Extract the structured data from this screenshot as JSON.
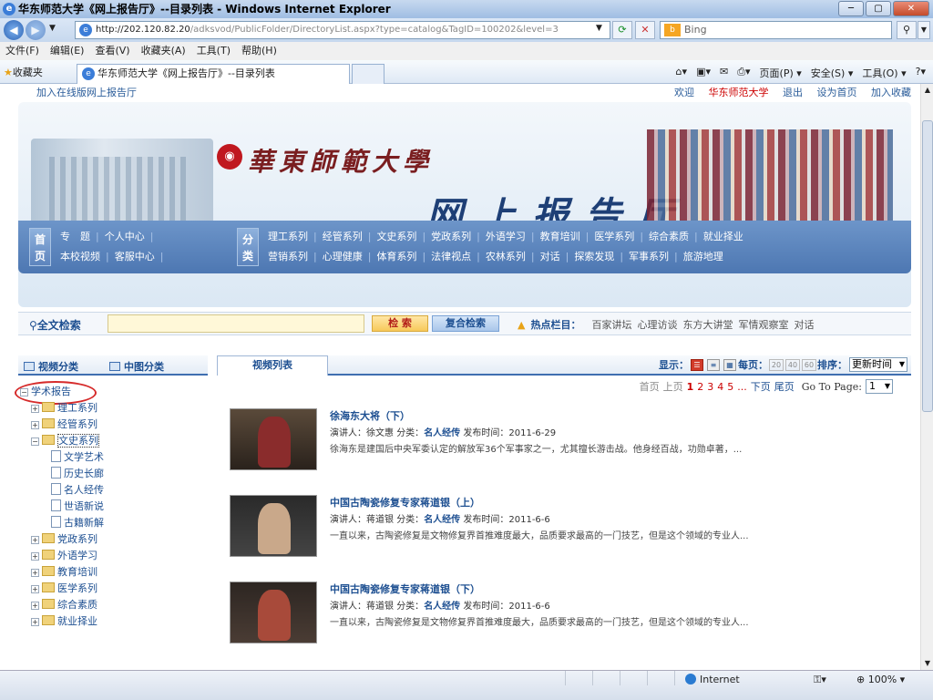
{
  "browser": {
    "title": "华东师范大学《网上报告厅》--目录列表 - Windows Internet Explorer",
    "url_host": "http://202.120.82.20",
    "url_path": "/adksvod/PublicFolder/DirectoryList.aspx?type=catalog&TagID=100202&level=3",
    "search_placeholder": "Bing",
    "menu": [
      "文件(F)",
      "编辑(E)",
      "查看(V)",
      "收藏夹(A)",
      "工具(T)",
      "帮助(H)"
    ],
    "favorites_label": "收藏夹",
    "tab_title": "华东师范大学《网上报告厅》--目录列表",
    "commands": [
      "页面(P) ▾",
      "安全(S) ▾",
      "工具(O) ▾"
    ],
    "status_zone": "Internet",
    "zoom": "100%"
  },
  "site": {
    "add_hall": "加入在线版网上报告厅",
    "welcome_prefix": "欢迎",
    "user": "华东师范大学",
    "logout": "退出",
    "set_home": "设为首页",
    "add_fav": "加入收藏",
    "university": "華東師範大學",
    "hall_name": "网上报告厅"
  },
  "nav": {
    "home": "首页",
    "category": "分类",
    "row1_left": [
      "专　题",
      "个人中心"
    ],
    "row2_left": [
      "本校视频",
      "客服中心"
    ],
    "row1_right": [
      "理工系列",
      "经管系列",
      "文史系列",
      "党政系列",
      "外语学习",
      "教育培训",
      "医学系列",
      "综合素质",
      "就业择业"
    ],
    "row2_right": [
      "营销系列",
      "心理健康",
      "体育系列",
      "法律视点",
      "农林系列",
      "对话",
      "探索发现",
      "军事系列",
      "旅游地理"
    ]
  },
  "search": {
    "label": "全文检索",
    "search_btn": "检 索",
    "adv_btn": "复合检索",
    "hot_label": "热点栏目：",
    "hot_items": [
      "百家讲坛",
      "心理访谈",
      "东方大讲堂",
      "军情观察室",
      "对话"
    ]
  },
  "left": {
    "tab_video": "视频分类",
    "tab_cn": "中图分类",
    "root": "学术报告",
    "nodes": [
      {
        "label": "理工系列",
        "type": "folder",
        "level": 1
      },
      {
        "label": "经管系列",
        "type": "folder",
        "level": 1
      },
      {
        "label": "文史系列",
        "type": "folder",
        "level": 1,
        "expanded": true
      },
      {
        "label": "文学艺术",
        "type": "doc",
        "level": 2
      },
      {
        "label": "历史长廊",
        "type": "doc",
        "level": 2
      },
      {
        "label": "名人经传",
        "type": "doc",
        "level": 2
      },
      {
        "label": "世语新说",
        "type": "doc",
        "level": 2
      },
      {
        "label": "古籍新解",
        "type": "doc",
        "level": 2
      },
      {
        "label": "党政系列",
        "type": "folder",
        "level": 1
      },
      {
        "label": "外语学习",
        "type": "folder",
        "level": 1
      },
      {
        "label": "教育培训",
        "type": "folder",
        "level": 1
      },
      {
        "label": "医学系列",
        "type": "folder",
        "level": 1
      },
      {
        "label": "综合素质",
        "type": "folder",
        "level": 1
      },
      {
        "label": "就业择业",
        "type": "folder",
        "level": 1
      }
    ]
  },
  "list": {
    "tab": "视频列表",
    "display_label": "显示：",
    "per_page_label": "每页：",
    "per_page_options": [
      "20",
      "40",
      "60"
    ],
    "sort_label": "排序：",
    "sort_value": "更新时间",
    "pager": {
      "first": "首页",
      "prev": "上页",
      "pages": [
        "1",
        "2",
        "3",
        "4",
        "5"
      ],
      "ellipsis": "...",
      "next": "下页",
      "last": "尾页",
      "goto_label": "Go To Page:",
      "goto_value": "1"
    },
    "items": [
      {
        "title": "徐海东大将（下）",
        "speaker_label": "演讲人：",
        "speaker": "徐文惠",
        "cat_label": "分类：",
        "category": "名人经传",
        "date_label": "发布时间：",
        "date": "2011-6-29",
        "desc": "徐海东是建国后中央军委认定的解放军36个军事家之一，尤其擅长游击战。他身经百战，功勋卓著，..."
      },
      {
        "title": "中国古陶瓷修复专家蒋道银（上）",
        "speaker_label": "演讲人：",
        "speaker": "蒋道银",
        "cat_label": "分类：",
        "category": "名人经传",
        "date_label": "发布时间：",
        "date": "2011-6-6",
        "desc": "一直以来，古陶瓷修复是文物修复界首推难度最大，品质要求最高的一门技艺，但是这个领域的专业人..."
      },
      {
        "title": "中国古陶瓷修复专家蒋道银（下）",
        "speaker_label": "演讲人：",
        "speaker": "蒋道银",
        "cat_label": "分类：",
        "category": "名人经传",
        "date_label": "发布时间：",
        "date": "2011-6-6",
        "desc": "一直以来，古陶瓷修复是文物修复界首推难度最大，品质要求最高的一门技艺，但是这个领域的专业人..."
      }
    ]
  }
}
